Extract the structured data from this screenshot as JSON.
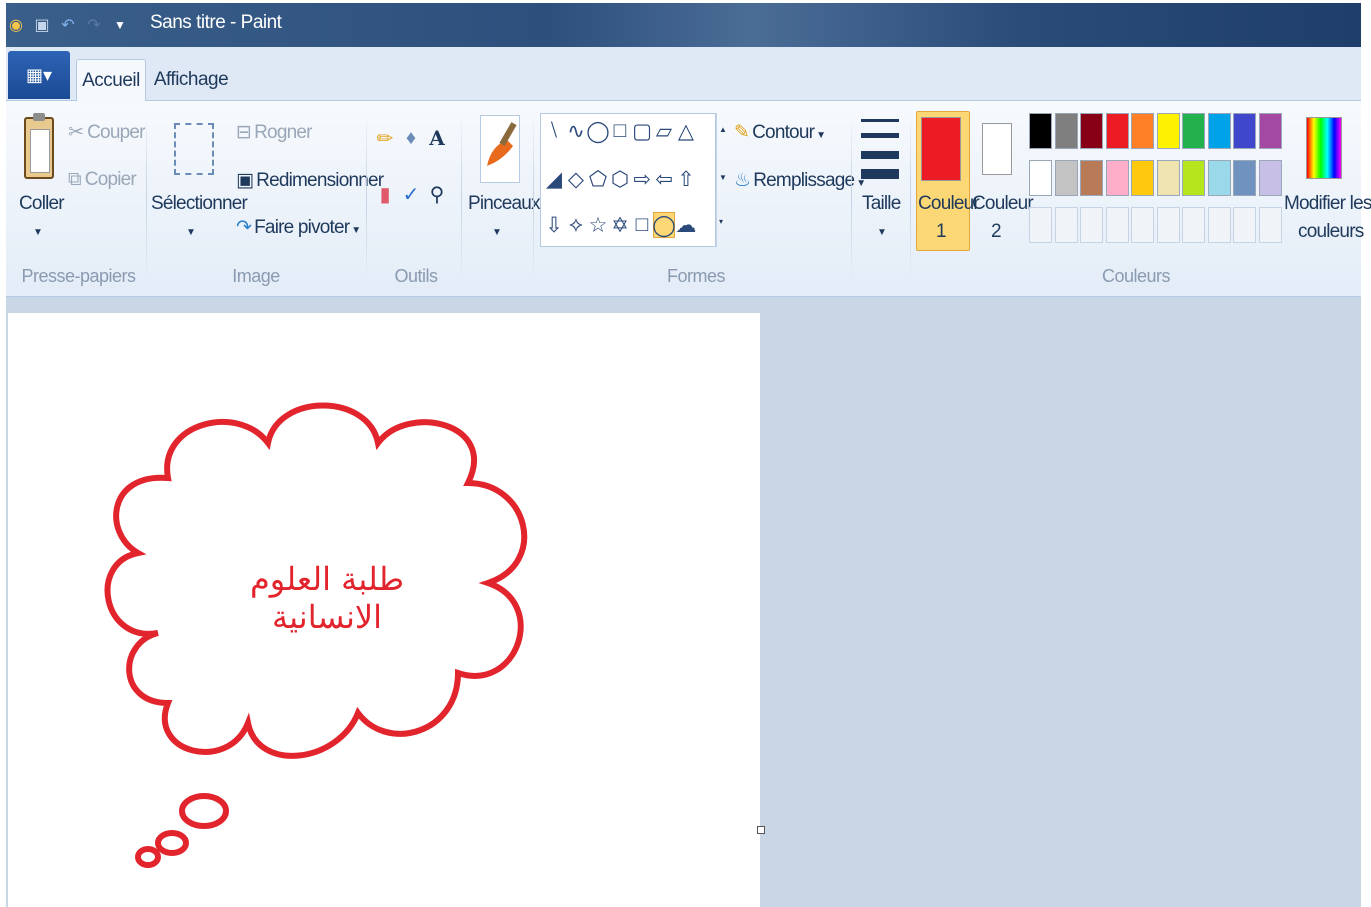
{
  "window": {
    "title": "Sans titre - Paint"
  },
  "tabs": [
    {
      "label": "Accueil"
    },
    {
      "label": "Affichage"
    }
  ],
  "ribbon": {
    "clipboard": {
      "paste": "Coller",
      "cut": "Couper",
      "copy": "Copier",
      "group": "Presse-papiers"
    },
    "image": {
      "select": "Sélectionner",
      "crop": "Rogner",
      "resize": "Redimensionner",
      "rotate": "Faire pivoter",
      "group": "Image"
    },
    "tools": {
      "group": "Outils"
    },
    "brushes": {
      "label": "Pinceaux"
    },
    "shapes": {
      "outline": "Contour",
      "fill": "Remplissage",
      "group": "Formes"
    },
    "size": {
      "label": "Taille"
    },
    "colors": {
      "color1_line1": "Couleur",
      "color1_line2": "1",
      "color2_line1": "Couleur",
      "color2_line2": "2",
      "edit_line1": "Modifier les",
      "edit_line2": "couleurs",
      "group": "Couleurs",
      "color1_value": "#ed1c24",
      "color2_value": "#ffffff",
      "row1": [
        "#000000",
        "#7f7f7f",
        "#880015",
        "#ed1c24",
        "#ff7f27",
        "#fff200",
        "#22b14c",
        "#00a2e8",
        "#3f48cc",
        "#a349a4"
      ],
      "row2": [
        "#ffffff",
        "#c3c3c3",
        "#b97a57",
        "#ffaec9",
        "#ffc90e",
        "#efe4b0",
        "#b5e61d",
        "#99d9ea",
        "#7092be",
        "#c8bfe7"
      ]
    }
  },
  "canvas": {
    "text": "طلبة العلوم الانسانية",
    "stroke_color": "#e2242c"
  }
}
